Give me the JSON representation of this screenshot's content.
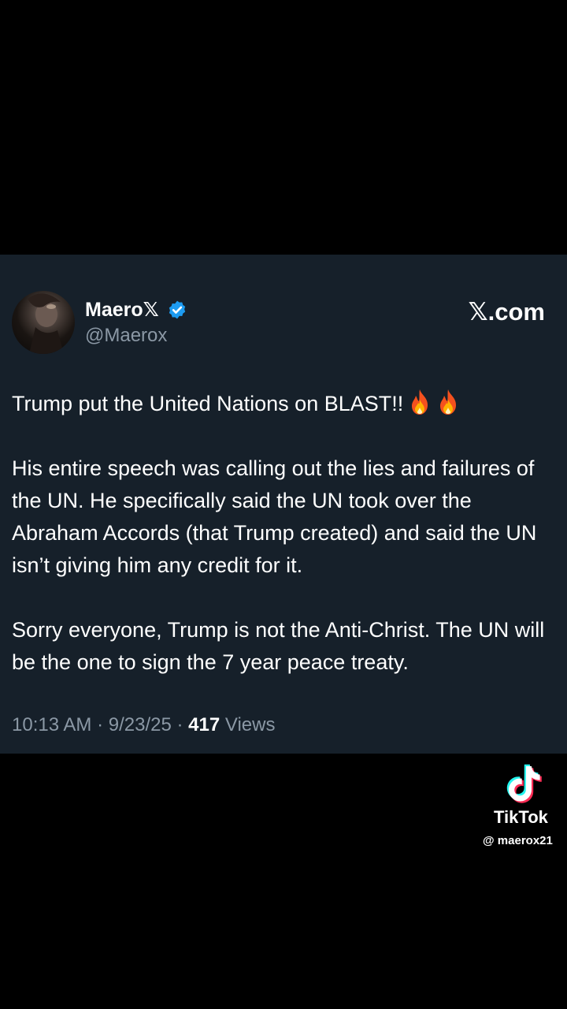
{
  "tweet": {
    "display_name": "Maero𝕏",
    "handle": "@Maerox",
    "site_label": "𝕏.com",
    "paragraphs": [
      "Trump put the United Nations on BLAST!!",
      "His entire speech was calling out the lies and failures of the UN. He specifically said the UN took over the Abraham Accords (that Trump created) and said the UN isn’t giving him any credit for it.",
      "Sorry everyone, Trump is not the Anti-Christ. The UN will be the one to sign the 7 year peace treaty."
    ],
    "time": "10:13 AM",
    "date": "9/23/25",
    "views_count": "417",
    "views_label": "Views",
    "separator": "·"
  },
  "watermark": {
    "name": "TikTok",
    "handle": "@ maerox21"
  },
  "colors": {
    "card_background": "#16202a",
    "page_background": "#000000",
    "verified_badge": "#1d9bf0",
    "secondary_text": "#8b98a5"
  },
  "icons": [
    "avatar",
    "verified-badge-icon",
    "fire-icon",
    "tiktok-logo-icon"
  ]
}
